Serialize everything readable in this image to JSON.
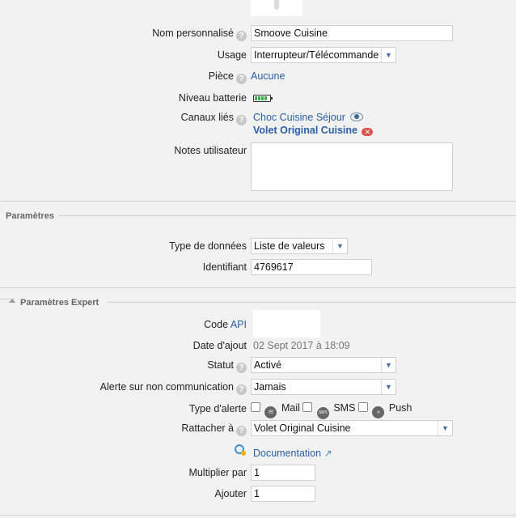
{
  "device": {
    "custom_name_label": "Nom personnalisé",
    "custom_name_value": "Smoove Cuisine",
    "usage_label": "Usage",
    "usage_value": "Interrupteur/Télécommande",
    "room_label": "Pièce",
    "room_value": "Aucune",
    "battery_label": "Niveau batterie",
    "linked_channels_label": "Canaux liés",
    "linked_channels": [
      "Choc Cuisine Séjour",
      "Volet Original Cuisine"
    ],
    "notes_label": "Notes utilisateur",
    "notes_value": ""
  },
  "parameters": {
    "title": "Paramètres",
    "data_type_label": "Type de données",
    "data_type_value": "Liste de valeurs",
    "identifier_label": "Identifiant",
    "identifier_value": "4769617"
  },
  "expert": {
    "title": "Paramètres Expert",
    "api_code_label": "Code",
    "api_code_link": "API",
    "date_added_label": "Date d'ajout",
    "date_added_value": "02 Sept 2017 à 18:09",
    "status_label": "Statut",
    "status_value": "Activé",
    "alert_noncomm_label": "Alerte sur non communication",
    "alert_noncomm_value": "Jamais",
    "alert_type_label": "Type d'alerte",
    "alert_types": [
      "Mail",
      "SMS",
      "Push"
    ],
    "attach_label": "Rattacher à",
    "attach_value": "Volet Original Cuisine",
    "documentation_link": "Documentation",
    "multiply_label": "Multiplier par",
    "multiply_value": "1",
    "add_label": "Ajouter",
    "add_value": "1"
  },
  "icons": {
    "help": "question-circle-icon",
    "battery": "battery-full-icon",
    "eye": "eye-icon",
    "remove": "remove-link-icon",
    "mail": "mail-icon",
    "sms": "sms-icon",
    "push": "push-icon",
    "doc": "documentation-icon",
    "external": "external-link-icon"
  },
  "colors": {
    "link": "#2b5fa8",
    "background": "#f2f2f2"
  }
}
